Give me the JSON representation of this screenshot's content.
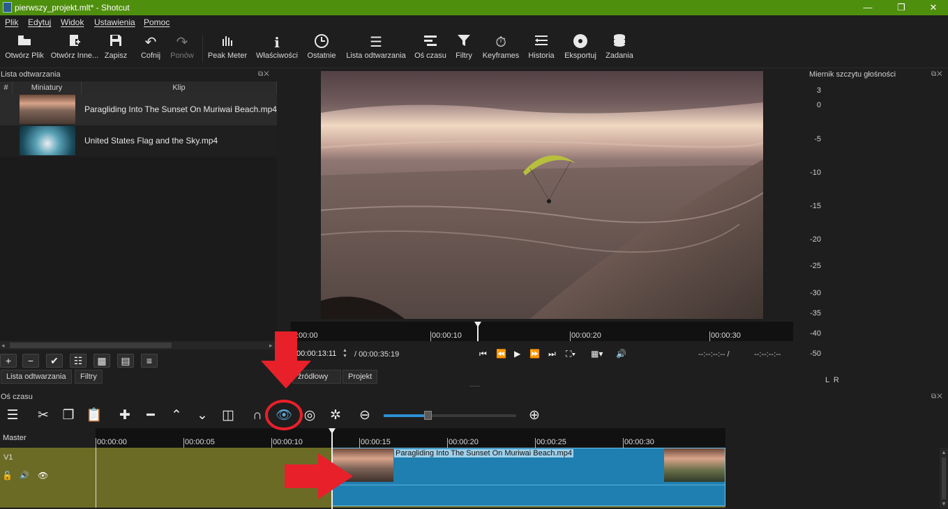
{
  "window": {
    "title": "pierwszy_projekt.mlt* - Shotcut",
    "controls": [
      "—",
      "❐",
      "✕"
    ]
  },
  "menu": [
    "Plik",
    "Edytuj",
    "Widok",
    "Ustawienia",
    "Pomoc"
  ],
  "toolbar": [
    {
      "label": "Otwórz Plik",
      "icon": "folder-open-icon"
    },
    {
      "label": "Otwórz Inne...",
      "icon": "open-other-icon"
    },
    {
      "label": "Zapisz",
      "icon": "save-icon"
    },
    {
      "label": "Cofnij",
      "icon": "undo-icon"
    },
    {
      "label": "Ponów",
      "icon": "redo-icon",
      "disabled": true
    },
    {
      "label": "Peak Meter",
      "icon": "peak-meter-icon"
    },
    {
      "label": "Właściwości",
      "icon": "properties-icon"
    },
    {
      "label": "Ostatnie",
      "icon": "recent-clock-icon"
    },
    {
      "label": "Lista odtwarzania",
      "icon": "playlist-icon"
    },
    {
      "label": "Oś czasu",
      "icon": "timeline-icon"
    },
    {
      "label": "Filtry",
      "icon": "filter-funnel-icon"
    },
    {
      "label": "Keyframes",
      "icon": "keyframes-stopwatch-icon"
    },
    {
      "label": "Historia",
      "icon": "history-icon"
    },
    {
      "label": "Eksportuj",
      "icon": "export-disc-icon"
    },
    {
      "label": "Zadania",
      "icon": "jobs-stack-icon"
    }
  ],
  "playlist": {
    "title": "Lista odtwarzania",
    "columns": [
      "#",
      "Miniatury",
      "Klip"
    ],
    "items": [
      {
        "clip": "Paragliding Into The Sunset On Muriwai Beach.mp4"
      },
      {
        "clip": "United States Flag and the Sky.mp4"
      }
    ],
    "tabs": [
      "Lista odtwarzania",
      "Filtry"
    ]
  },
  "player": {
    "ruler_labels": [
      "00:00:00",
      "00:00:10",
      "00:00:20",
      "00:00:30"
    ],
    "ruler_first_visible": ":00:00",
    "current_time": "00:00:13:11",
    "duration": "/ 00:00:35:19",
    "in_point": "--:--:--:-- /",
    "out_point": "--:--:--:--",
    "tabs": [
      "źródłowy",
      "Projekt"
    ]
  },
  "meter": {
    "title": "Miernik szczytu głośności",
    "scale": [
      "3",
      "0",
      "-5",
      "-10",
      "-15",
      "-20",
      "-25",
      "-30",
      "-35",
      "-40",
      "-50"
    ],
    "channels": "L  R"
  },
  "timeline": {
    "title": "Oś czasu",
    "master_label": "Master",
    "track_label": "V1",
    "ruler_labels": [
      "00:00:00",
      "00:00:05",
      "00:00:10",
      "00:00:15",
      "00:00:20",
      "00:00:25",
      "00:00:30"
    ],
    "clip_title": "Paragliding Into The Sunset On Muriwai Beach.mp4",
    "zoom_level": 0.33
  }
}
